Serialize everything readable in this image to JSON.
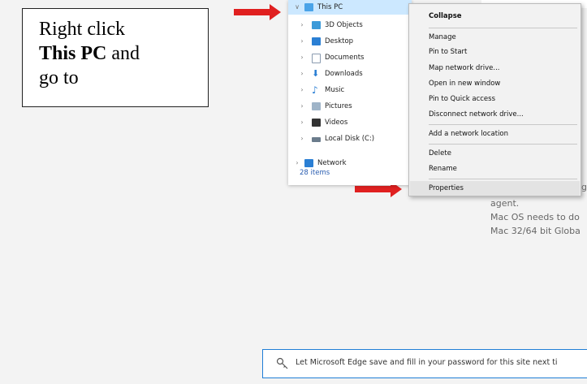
{
  "instruction": {
    "line1": "Right click",
    "line2_bold": "This PC",
    "line2_rest": " and",
    "line3": "go to"
  },
  "tree": {
    "items": [
      {
        "label": "This PC",
        "icon": "monitor-icon",
        "expanded": true,
        "selected": true
      },
      {
        "label": "3D Objects",
        "icon": "cube-icon"
      },
      {
        "label": "Desktop",
        "icon": "desktop-icon"
      },
      {
        "label": "Documents",
        "icon": "document-icon"
      },
      {
        "label": "Downloads",
        "icon": "download-arrow-icon"
      },
      {
        "label": "Music",
        "icon": "music-note-icon"
      },
      {
        "label": "Pictures",
        "icon": "pictures-icon"
      },
      {
        "label": "Videos",
        "icon": "film-icon"
      },
      {
        "label": "Local Disk (C:)",
        "icon": "drive-icon"
      },
      {
        "label": "Network",
        "icon": "network-icon"
      }
    ],
    "status": "28 items"
  },
  "context_menu": {
    "items": [
      "Collapse",
      "Manage",
      "Pin to Start",
      "Map network drive...",
      "Open in new window",
      "Pin to Quick access",
      "Disconnect network drive...",
      "Add a network location",
      "Delete",
      "Rename",
      "Properties"
    ]
  },
  "background": {
    "line1": "agent.",
    "line2": "Mac OS needs to do",
    "line3": "Mac 32/64 bit Globa",
    "partial": "g"
  },
  "edge_bar": {
    "message": "Let Microsoft Edge save and fill in your password for this site next ti",
    "icon": "key-icon"
  },
  "colors": {
    "arrow": "#e02020",
    "selection": "#cce8ff",
    "edge_border": "#1f7ed6"
  }
}
